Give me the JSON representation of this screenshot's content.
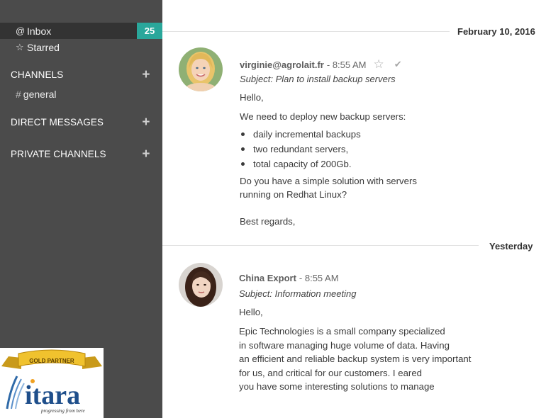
{
  "sidebar": {
    "inbox": {
      "icon": "at-icon",
      "label": "Inbox",
      "count": "25"
    },
    "starred": {
      "icon": "star-icon",
      "label": "Starred"
    },
    "sections": {
      "channels": "CHANNELS",
      "direct_messages": "DIRECT MESSAGES",
      "private_channels": "PRIVATE CHANNELS"
    },
    "plus": "+",
    "channels": [
      {
        "label": "general"
      }
    ]
  },
  "logo": {
    "banner": "GOLD PARTNER",
    "name": "itara",
    "tagline": "progressing from here"
  },
  "messages": [
    {
      "date": "February 10, 2016",
      "author": "virginie@agrolait.fr",
      "time": "- 8:55 AM",
      "subject": "Subject: Plan to install backup servers",
      "greeting": "Hello,",
      "intro": "We need to deploy new backup servers:",
      "bullets": [
        "daily incremental backups",
        "two redundant servers,",
        "total capacity of 200Gb."
      ],
      "question_1": "Do you have a simple solution with servers",
      "question_2": "running on Redhat Linux?",
      "closing": "Best regards,"
    },
    {
      "date": "Yesterday",
      "author": "China Export",
      "time": "- 8:55 AM",
      "subject": "Subject: Information meeting",
      "greeting": "Hello,",
      "body": [
        "Epic Technologies is a small company specialized",
        "in software managing huge volume of data. Having",
        "an efficient and reliable backup system is very important",
        "for us, and critical for our customers. I eared",
        "you have some interesting solutions to manage"
      ]
    }
  ],
  "colors": {
    "sidebar": "#4b4b4b",
    "sidebar_active": "#333333",
    "badge": "#2aa79b"
  }
}
